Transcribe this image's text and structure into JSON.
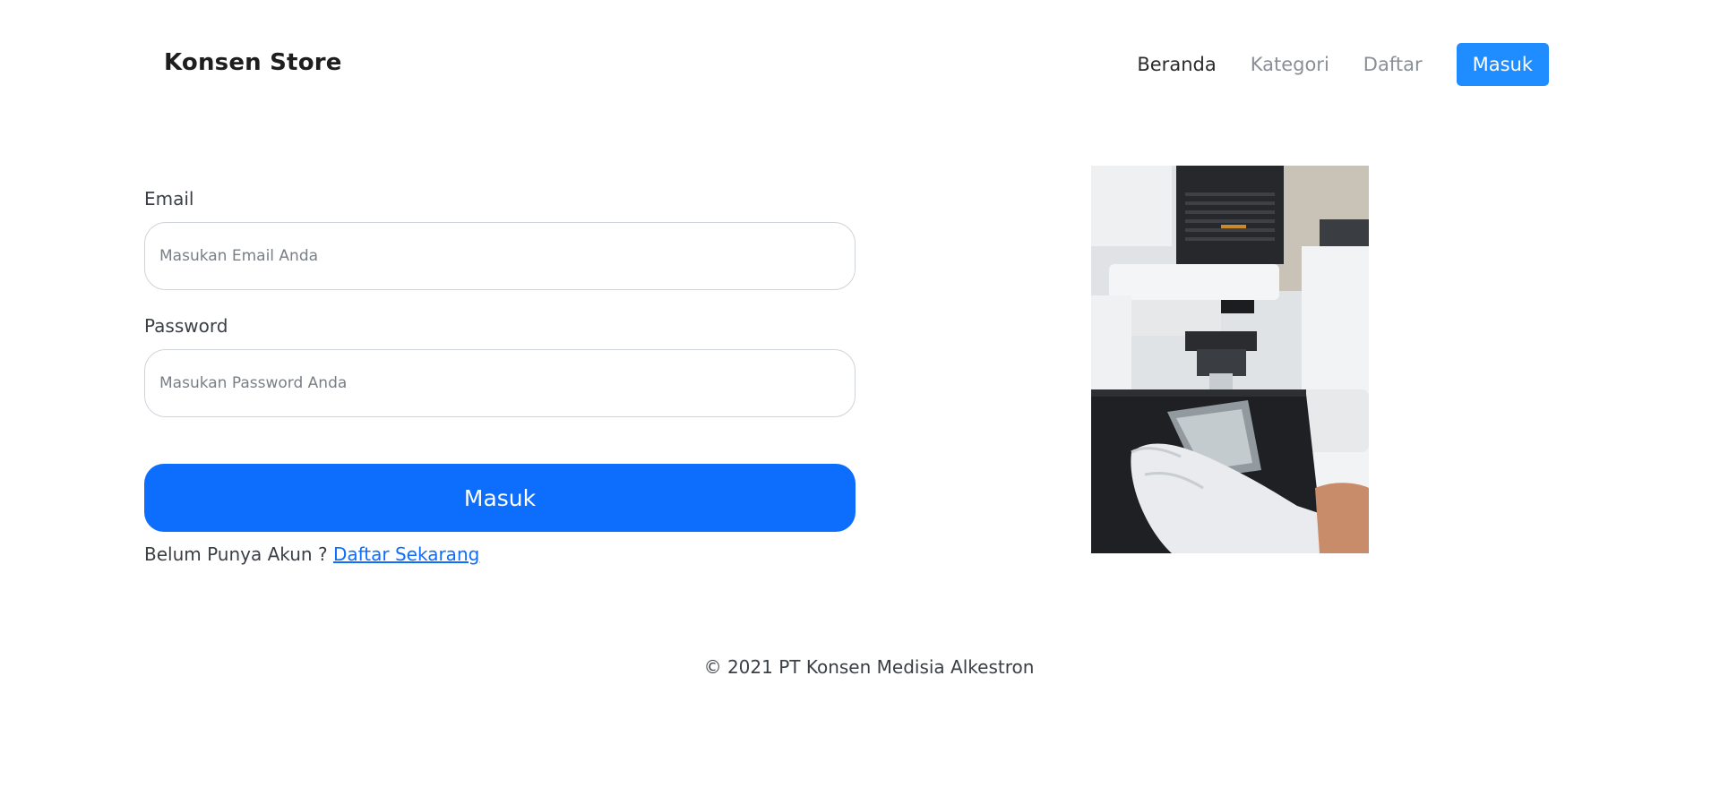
{
  "navbar": {
    "brand": "Konsen Store",
    "links": [
      "Beranda",
      "Kategori",
      "Daftar"
    ],
    "login_button": "Masuk"
  },
  "form": {
    "email_label": "Email",
    "email_placeholder": "Masukan Email Anda",
    "email_value": "",
    "password_label": "Password",
    "password_placeholder": "Masukan Password Anda",
    "password_value": "",
    "submit_label": "Masuk",
    "register_prompt": "Belum Punya Akun ?",
    "register_link": "Daftar Sekarang"
  },
  "footer": {
    "copyright": "© 2021 PT Konsen Medisia Alkestron"
  },
  "colors": {
    "primary": "#0d6efd",
    "nav_button": "#1f8cff",
    "muted_link": "#8a8f96"
  }
}
